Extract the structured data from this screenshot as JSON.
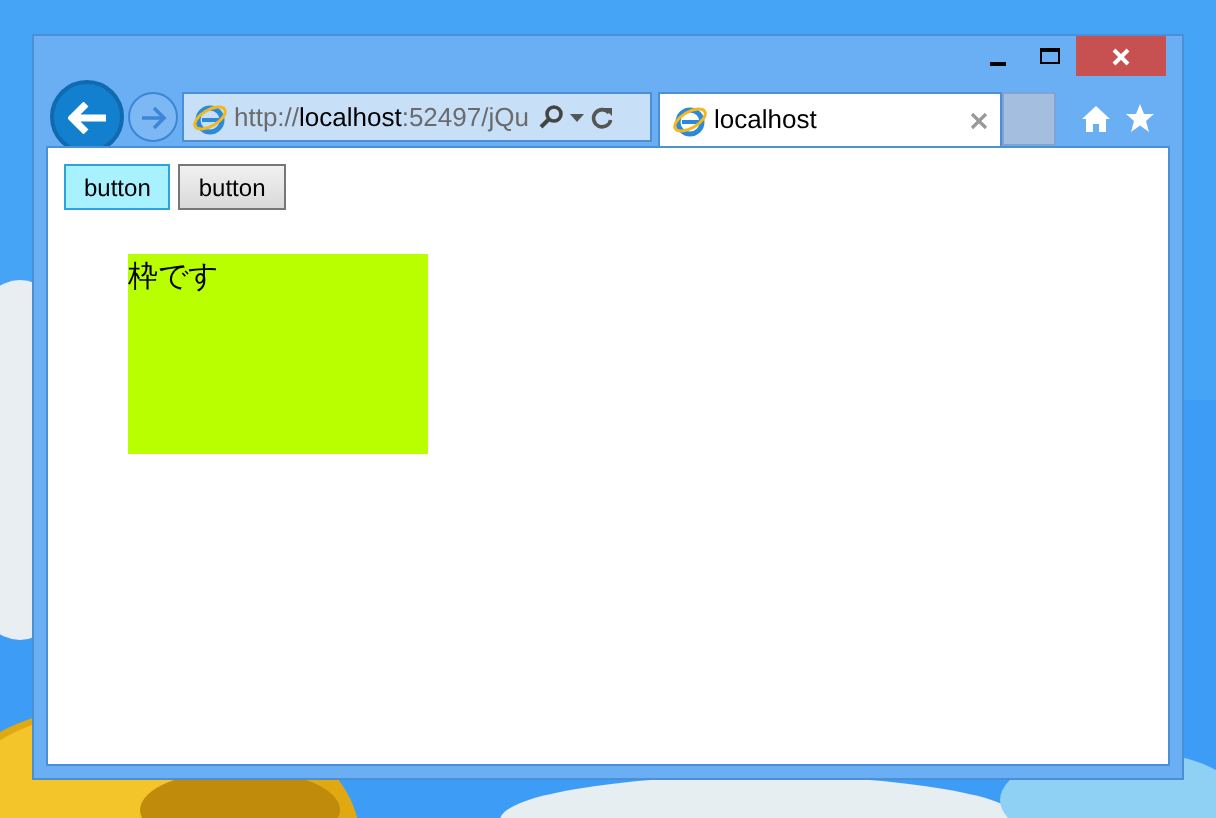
{
  "browser": {
    "address": {
      "scheme": "http://",
      "host": "localhost",
      "rest": ":52497/jQu"
    },
    "tab": {
      "title": "localhost",
      "selected": true
    }
  },
  "page": {
    "buttons": [
      {
        "label": "button",
        "highlighted": true
      },
      {
        "label": "button",
        "highlighted": false
      }
    ],
    "frame": {
      "text": "枠です",
      "color": "#b9ff00"
    }
  }
}
